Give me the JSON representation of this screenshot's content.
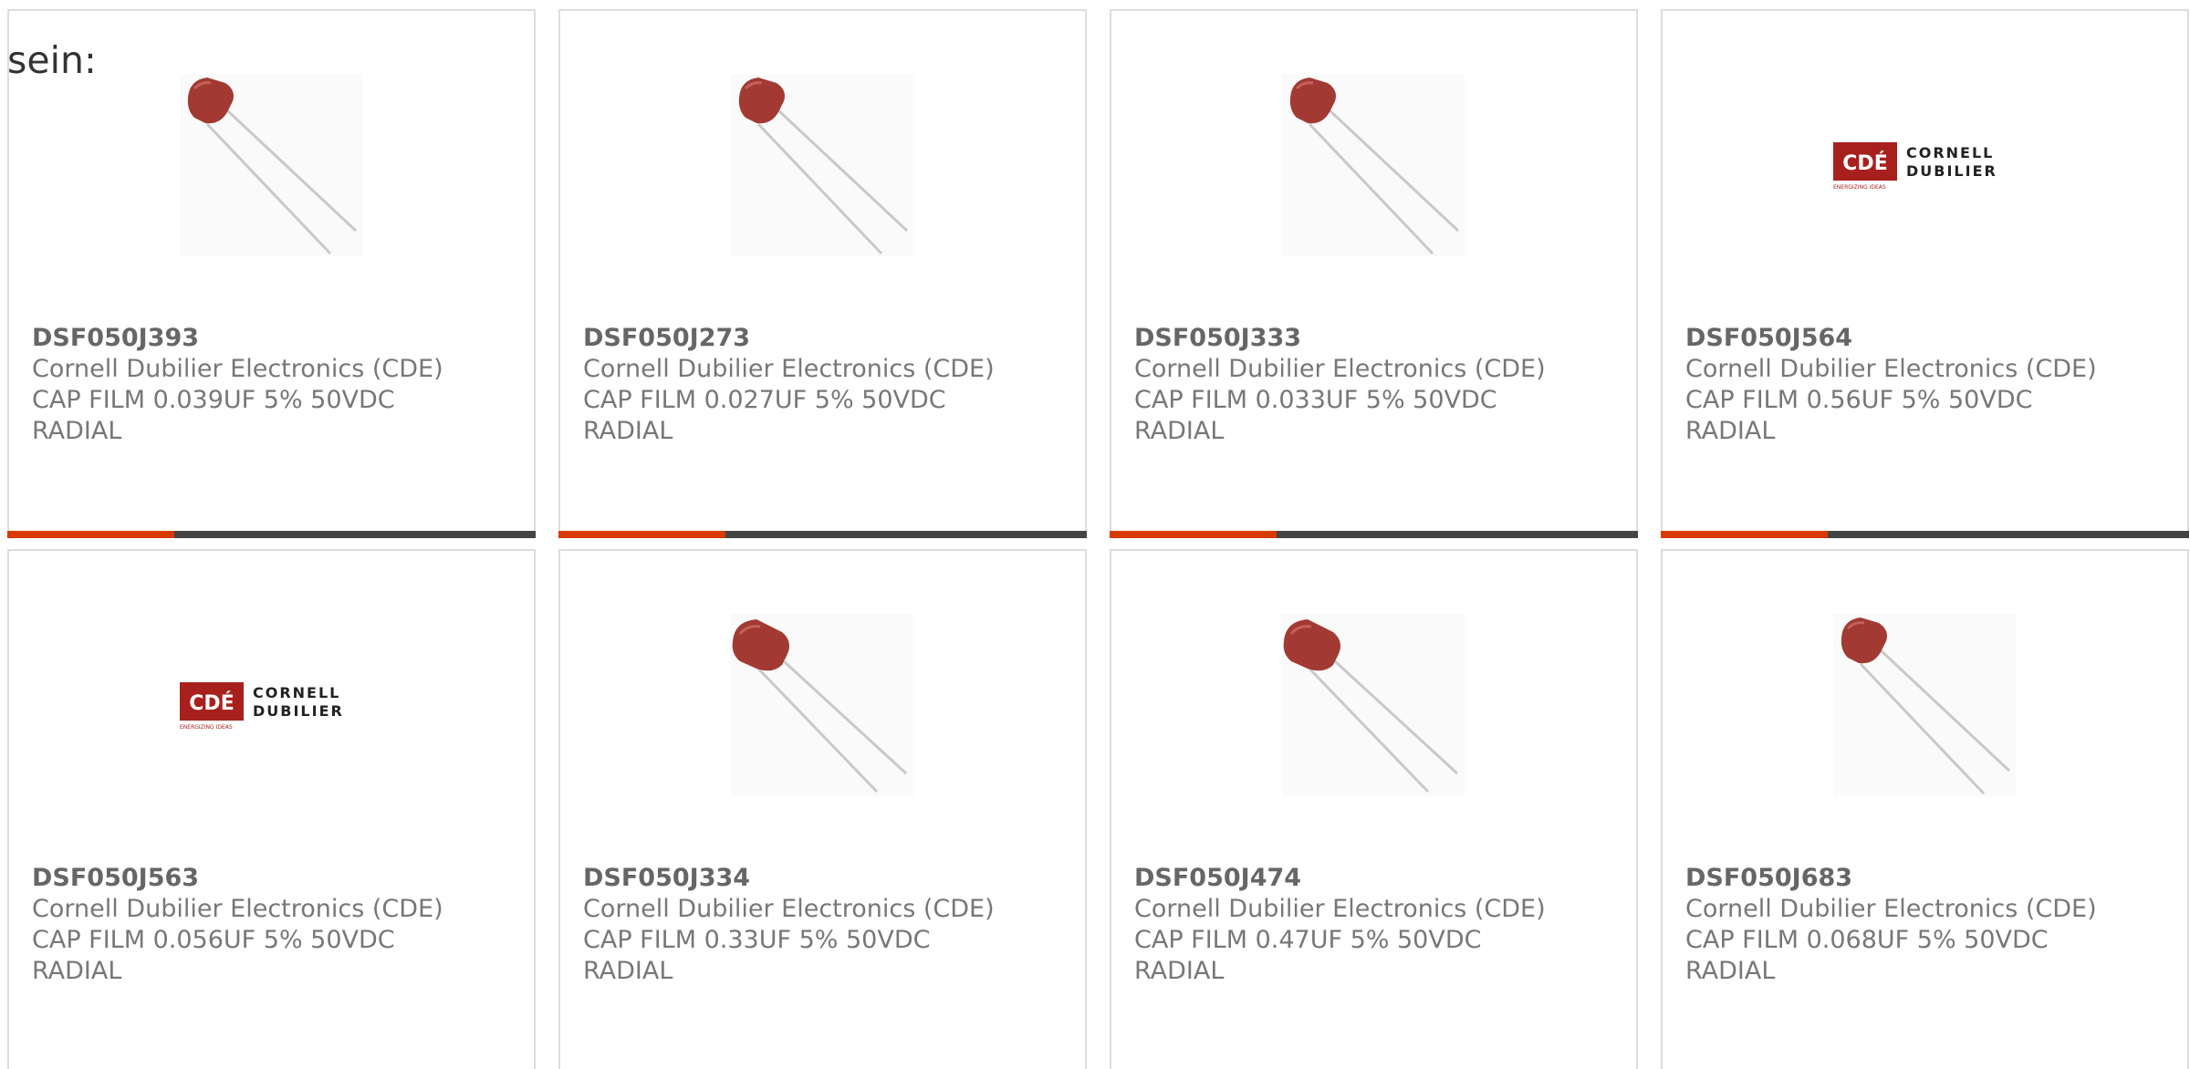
{
  "intro_text": "sein:",
  "colors": {
    "accent": "#d83b01",
    "bar_dark": "#444444",
    "border": "#dddddd",
    "cap_body": "#a23a33",
    "logo_red": "#a8201d"
  },
  "products": [
    {
      "part": "DSF050J393",
      "manufacturer": "Cornell Dubilier Electronics (CDE)",
      "desc1": "CAP FILM 0.039UF 5% 50VDC",
      "desc2": "RADIAL",
      "image": "capacitor-photo"
    },
    {
      "part": "DSF050J273",
      "manufacturer": "Cornell Dubilier Electronics (CDE)",
      "desc1": "CAP FILM 0.027UF 5% 50VDC",
      "desc2": "RADIAL",
      "image": "capacitor-photo"
    },
    {
      "part": "DSF050J333",
      "manufacturer": "Cornell Dubilier Electronics (CDE)",
      "desc1": "CAP FILM 0.033UF 5% 50VDC",
      "desc2": "RADIAL",
      "image": "capacitor-photo"
    },
    {
      "part": "DSF050J564",
      "manufacturer": "Cornell Dubilier Electronics (CDE)",
      "desc1": "CAP FILM 0.56UF 5% 50VDC",
      "desc2": "RADIAL",
      "image": "cde-logo"
    },
    {
      "part": "DSF050J563",
      "manufacturer": "Cornell Dubilier Electronics (CDE)",
      "desc1": "CAP FILM 0.056UF 5% 50VDC",
      "desc2": "RADIAL",
      "image": "cde-logo"
    },
    {
      "part": "DSF050J334",
      "manufacturer": "Cornell Dubilier Electronics (CDE)",
      "desc1": "CAP FILM 0.33UF 5% 50VDC",
      "desc2": "RADIAL",
      "image": "capacitor-photo"
    },
    {
      "part": "DSF050J474",
      "manufacturer": "Cornell Dubilier Electronics (CDE)",
      "desc1": "CAP FILM 0.47UF 5% 50VDC",
      "desc2": "RADIAL",
      "image": "capacitor-photo"
    },
    {
      "part": "DSF050J683",
      "manufacturer": "Cornell Dubilier Electronics (CDE)",
      "desc1": "CAP FILM 0.068UF 5% 50VDC",
      "desc2": "RADIAL",
      "image": "capacitor-photo"
    }
  ],
  "logo": {
    "mark": "CDÉ",
    "line1": "CORNELL",
    "line2": "DUBILIER",
    "tagline": "ENERGIZING IDEAS"
  }
}
